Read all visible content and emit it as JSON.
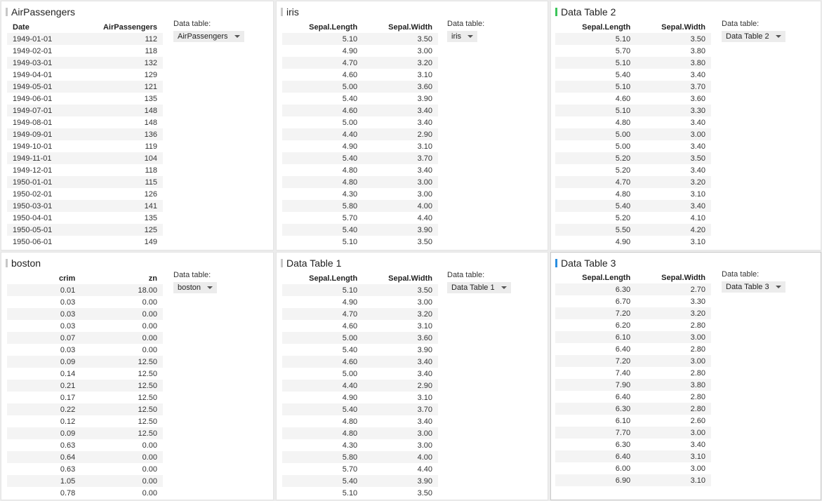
{
  "common": {
    "data_table_label": "Data table:"
  },
  "panels": [
    {
      "title": "AirPassengers",
      "accent": "#c7c7c7",
      "selected": "AirPassengers",
      "headers": [
        "Date",
        "AirPassengers"
      ],
      "rows": [
        [
          "1949-01-01",
          "112"
        ],
        [
          "1949-02-01",
          "118"
        ],
        [
          "1949-03-01",
          "132"
        ],
        [
          "1949-04-01",
          "129"
        ],
        [
          "1949-05-01",
          "121"
        ],
        [
          "1949-06-01",
          "135"
        ],
        [
          "1949-07-01",
          "148"
        ],
        [
          "1949-08-01",
          "148"
        ],
        [
          "1949-09-01",
          "136"
        ],
        [
          "1949-10-01",
          "119"
        ],
        [
          "1949-11-01",
          "104"
        ],
        [
          "1949-12-01",
          "118"
        ],
        [
          "1950-01-01",
          "115"
        ],
        [
          "1950-02-01",
          "126"
        ],
        [
          "1950-03-01",
          "141"
        ],
        [
          "1950-04-01",
          "135"
        ],
        [
          "1950-05-01",
          "125"
        ],
        [
          "1950-06-01",
          "149"
        ]
      ]
    },
    {
      "title": "iris",
      "accent": "#c7c7c7",
      "selected": "iris",
      "headers": [
        "Sepal.Length",
        "Sepal.Width"
      ],
      "rows": [
        [
          "5.10",
          "3.50"
        ],
        [
          "4.90",
          "3.00"
        ],
        [
          "4.70",
          "3.20"
        ],
        [
          "4.60",
          "3.10"
        ],
        [
          "5.00",
          "3.60"
        ],
        [
          "5.40",
          "3.90"
        ],
        [
          "4.60",
          "3.40"
        ],
        [
          "5.00",
          "3.40"
        ],
        [
          "4.40",
          "2.90"
        ],
        [
          "4.90",
          "3.10"
        ],
        [
          "5.40",
          "3.70"
        ],
        [
          "4.80",
          "3.40"
        ],
        [
          "4.80",
          "3.00"
        ],
        [
          "4.30",
          "3.00"
        ],
        [
          "5.80",
          "4.00"
        ],
        [
          "5.70",
          "4.40"
        ],
        [
          "5.40",
          "3.90"
        ],
        [
          "5.10",
          "3.50"
        ]
      ]
    },
    {
      "title": "Data Table 2",
      "accent": "#3cc55a",
      "selected": "Data Table 2",
      "headers": [
        "Sepal.Length",
        "Sepal.Width"
      ],
      "rows": [
        [
          "5.10",
          "3.50"
        ],
        [
          "5.70",
          "3.80"
        ],
        [
          "5.10",
          "3.80"
        ],
        [
          "5.40",
          "3.40"
        ],
        [
          "5.10",
          "3.70"
        ],
        [
          "4.60",
          "3.60"
        ],
        [
          "5.10",
          "3.30"
        ],
        [
          "4.80",
          "3.40"
        ],
        [
          "5.00",
          "3.00"
        ],
        [
          "5.00",
          "3.40"
        ],
        [
          "5.20",
          "3.50"
        ],
        [
          "5.20",
          "3.40"
        ],
        [
          "4.70",
          "3.20"
        ],
        [
          "4.80",
          "3.10"
        ],
        [
          "5.40",
          "3.40"
        ],
        [
          "5.20",
          "4.10"
        ],
        [
          "5.50",
          "4.20"
        ],
        [
          "4.90",
          "3.10"
        ]
      ]
    },
    {
      "title": "boston",
      "accent": "#c7c7c7",
      "selected": "boston",
      "headers": [
        "crim",
        "zn"
      ],
      "rows": [
        [
          "0.01",
          "18.00"
        ],
        [
          "0.03",
          "0.00"
        ],
        [
          "0.03",
          "0.00"
        ],
        [
          "0.03",
          "0.00"
        ],
        [
          "0.07",
          "0.00"
        ],
        [
          "0.03",
          "0.00"
        ],
        [
          "0.09",
          "12.50"
        ],
        [
          "0.14",
          "12.50"
        ],
        [
          "0.21",
          "12.50"
        ],
        [
          "0.17",
          "12.50"
        ],
        [
          "0.22",
          "12.50"
        ],
        [
          "0.12",
          "12.50"
        ],
        [
          "0.09",
          "12.50"
        ],
        [
          "0.63",
          "0.00"
        ],
        [
          "0.64",
          "0.00"
        ],
        [
          "0.63",
          "0.00"
        ],
        [
          "1.05",
          "0.00"
        ],
        [
          "0.78",
          "0.00"
        ]
      ]
    },
    {
      "title": "Data Table 1",
      "accent": "#c7c7c7",
      "selected": "Data Table 1",
      "headers": [
        "Sepal.Length",
        "Sepal.Width"
      ],
      "rows": [
        [
          "5.10",
          "3.50"
        ],
        [
          "4.90",
          "3.00"
        ],
        [
          "4.70",
          "3.20"
        ],
        [
          "4.60",
          "3.10"
        ],
        [
          "5.00",
          "3.60"
        ],
        [
          "5.40",
          "3.90"
        ],
        [
          "4.60",
          "3.40"
        ],
        [
          "5.00",
          "3.40"
        ],
        [
          "4.40",
          "2.90"
        ],
        [
          "4.90",
          "3.10"
        ],
        [
          "5.40",
          "3.70"
        ],
        [
          "4.80",
          "3.40"
        ],
        [
          "4.80",
          "3.00"
        ],
        [
          "4.30",
          "3.00"
        ],
        [
          "5.80",
          "4.00"
        ],
        [
          "5.70",
          "4.40"
        ],
        [
          "5.40",
          "3.90"
        ],
        [
          "5.10",
          "3.50"
        ]
      ]
    },
    {
      "title": "Data Table 3",
      "accent": "#2a8ee0",
      "selected": "Data Table 3",
      "headers": [
        "Sepal.Length",
        "Sepal.Width"
      ],
      "rows": [
        [
          "6.30",
          "2.70"
        ],
        [
          "6.70",
          "3.30"
        ],
        [
          "7.20",
          "3.20"
        ],
        [
          "6.20",
          "2.80"
        ],
        [
          "6.10",
          "3.00"
        ],
        [
          "6.40",
          "2.80"
        ],
        [
          "7.20",
          "3.00"
        ],
        [
          "7.40",
          "2.80"
        ],
        [
          "7.90",
          "3.80"
        ],
        [
          "6.40",
          "2.80"
        ],
        [
          "6.30",
          "2.80"
        ],
        [
          "6.10",
          "2.60"
        ],
        [
          "7.70",
          "3.00"
        ],
        [
          "6.30",
          "3.40"
        ],
        [
          "6.40",
          "3.10"
        ],
        [
          "6.00",
          "3.00"
        ],
        [
          "6.90",
          "3.10"
        ]
      ]
    }
  ]
}
